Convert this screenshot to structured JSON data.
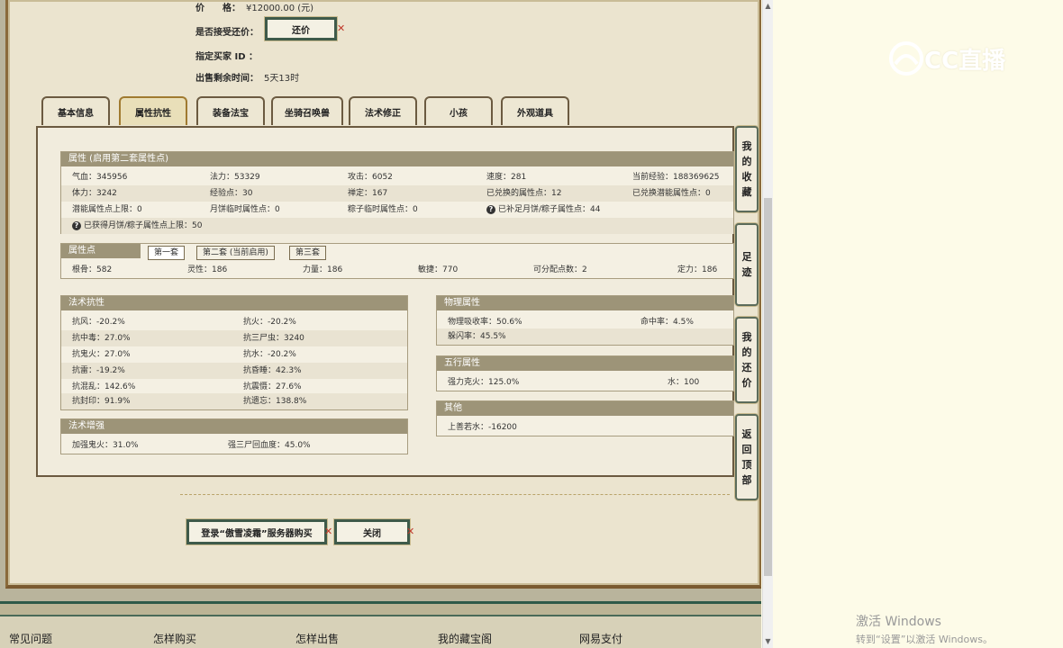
{
  "info": {
    "price_label": "价　　格：",
    "price_value": "¥12000.00 (元)",
    "counter_offer_label": "是否接受还价：",
    "counter_offer_button": "还价",
    "buyer_id_label": "指定买家 ID ：",
    "buyer_id_value": "",
    "remaining_label": "出售剩余时间：",
    "remaining_value": "5天13时"
  },
  "tabs": [
    "基本信息",
    "属性抗性",
    "装备法宝",
    "坐骑召唤兽",
    "法术修正",
    "小孩",
    "外观道具"
  ],
  "active_tab": "属性抗性",
  "attributes": {
    "header": "属性 (启用第二套属性点)",
    "rows": [
      [
        "气血：345956",
        "法力：53329",
        "攻击：6052",
        "速度：281",
        "当前经验：188369625"
      ],
      [
        "体力：3242",
        "经验点：30",
        "禅定：167",
        "已兑换的属性点：12",
        "已兑换潜能属性点：0"
      ],
      [
        "潜能属性点上限：0",
        "月饼临时属性点：0",
        "粽子临时属性点：0",
        "已补足月饼/粽子属性点：44",
        ""
      ]
    ],
    "note": "已获得月饼/粽子属性点上限：50"
  },
  "points": {
    "header": "属性点",
    "subtabs": [
      "第一套",
      "第二套 (当前启用)",
      "第三套"
    ],
    "values": [
      "根骨：582",
      "灵性：186",
      "力量：186",
      "敏捷：770",
      "可分配点数：2",
      "定力：186"
    ]
  },
  "resist": {
    "header": "法术抗性",
    "rows": [
      [
        "抗风：-20.2%",
        "抗火：-20.2%"
      ],
      [
        "抗中毒：27.0%",
        "抗三尸虫：3240"
      ],
      [
        "抗鬼火：27.0%",
        "抗水：-20.2%"
      ],
      [
        "抗雷：-19.2%",
        "抗昏睡：42.3%"
      ],
      [
        "抗混乱：142.6%",
        "抗震慑：27.6%"
      ],
      [
        "抗封印：91.9%",
        "抗遗忘：138.8%"
      ]
    ]
  },
  "boost": {
    "header": "法术增强",
    "row": [
      "加强鬼火：31.0%",
      "强三尸回血度：45.0%"
    ]
  },
  "physical": {
    "header": "物理属性",
    "rows": [
      [
        "物理吸收率：50.6%",
        "命中率：4.5%"
      ],
      [
        "躲闪率：45.5%",
        ""
      ]
    ]
  },
  "five": {
    "header": "五行属性",
    "row": [
      "强力克火：125.0%",
      "水：100"
    ]
  },
  "other": {
    "header": "其他",
    "row": [
      "上善若水：-16200"
    ]
  },
  "side_buttons": [
    [
      "我",
      "的",
      "收",
      "藏"
    ],
    [
      "足",
      "迹"
    ],
    [
      "我",
      "的",
      "还",
      "价"
    ],
    [
      "返",
      "回",
      "顶",
      "部"
    ]
  ],
  "bottom_buttons": {
    "login": "登录“傲雪凌霜”服务器购买",
    "close": "关闭"
  },
  "nav": [
    "常见问题",
    "怎样购买",
    "怎样出售",
    "我的藏宝阁",
    "网易支付"
  ],
  "logo_text": "CC直播",
  "windows": {
    "line1": "激活 Windows",
    "line2": "转到“设置”以激活 Windows。"
  },
  "help_glyph": "?",
  "close_glyph": "✕",
  "colors": {
    "accent_green": "#3e5a4a",
    "price_red": "#c0392b",
    "header_bg": "#9d9478"
  }
}
